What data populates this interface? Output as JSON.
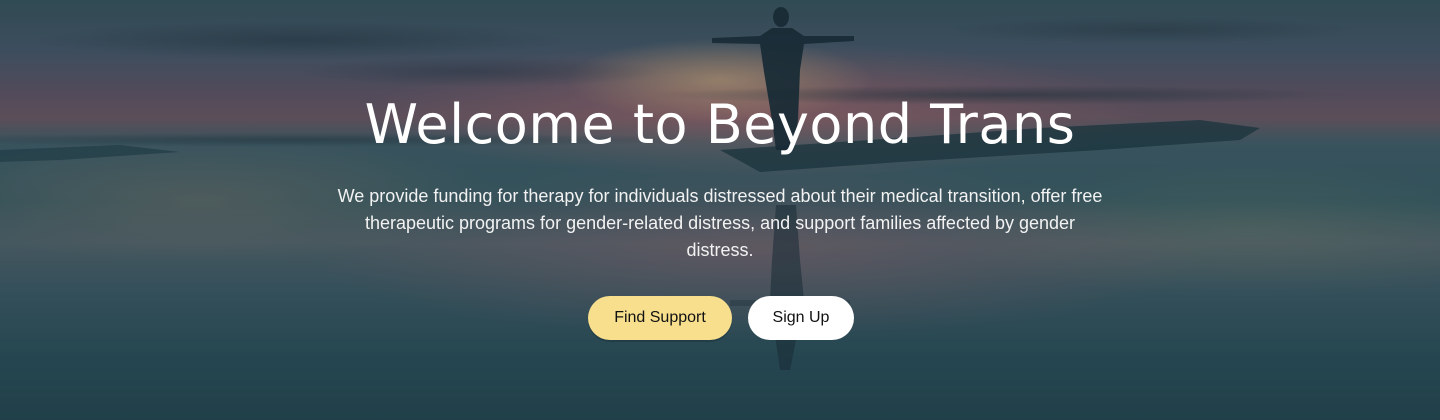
{
  "hero": {
    "title": "Welcome to Beyond Trans",
    "subtitle": "We provide funding for therapy for individuals distressed about their medical transition, offer free therapeutic programs for gender-related distress, and support families affected by gender distress.",
    "primary_button_label": "Find Support",
    "secondary_button_label": "Sign Up",
    "background_image": "silhouette-of-person-with-outstretched-arms-on-beach-at-sunset"
  },
  "colors": {
    "primary_button": "#f7df8e",
    "secondary_button": "#ffffff",
    "text": "#ffffff"
  }
}
